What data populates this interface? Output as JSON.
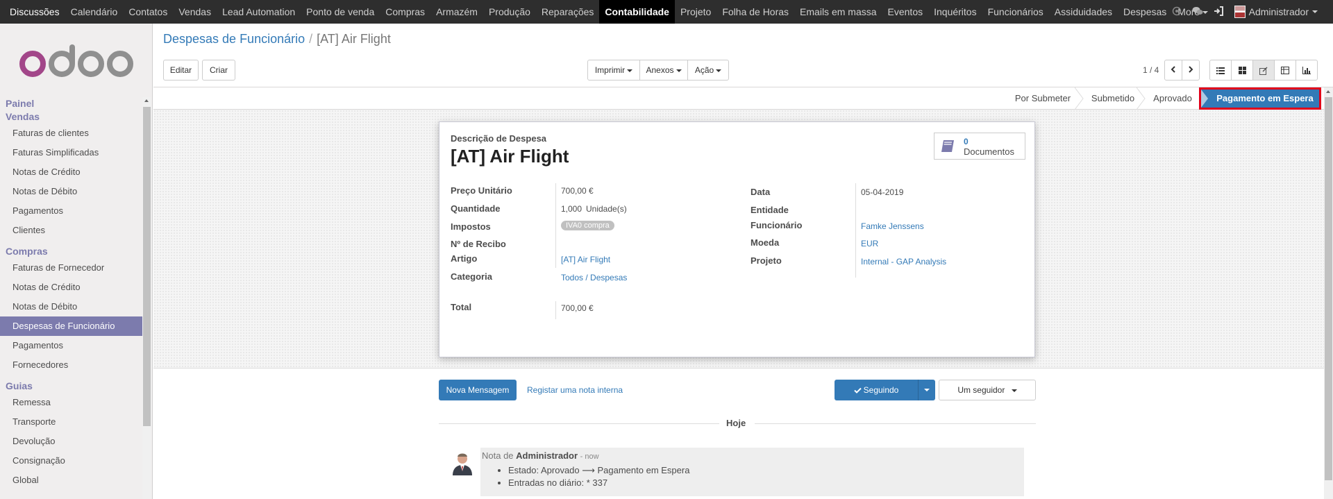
{
  "topbar": {
    "apps": [
      "Discussões",
      "Calendário",
      "Contatos",
      "Vendas",
      "Lead Automation",
      "Ponto de venda",
      "Compras",
      "Armazém",
      "Produção",
      "Reparações",
      "Contabilidade",
      "Projeto",
      "Folha de Horas",
      "Emails em massa",
      "Eventos",
      "Inquéritos",
      "Funcionários",
      "Assiduidades",
      "Despesas"
    ],
    "active_app": "Contabilidade",
    "more_label": "More",
    "user_name": "Administrador"
  },
  "sidebar": {
    "sections": [
      {
        "title": "Painel",
        "items": []
      },
      {
        "title": "Vendas",
        "items": [
          "Faturas de clientes",
          "Faturas Simplificadas",
          "Notas de Crédito",
          "Notas de Débito",
          "Pagamentos",
          "Clientes"
        ]
      },
      {
        "title": "Compras",
        "items": [
          "Faturas de Fornecedor",
          "Notas de Crédito",
          "Notas de Débito",
          "Despesas de Funcionário",
          "Pagamentos",
          "Fornecedores"
        ]
      },
      {
        "title": "Guias",
        "items": [
          "Remessa",
          "Transporte",
          "Devolução",
          "Consignação",
          "Global"
        ]
      }
    ],
    "active_item": "Despesas de Funcionário"
  },
  "breadcrumb": {
    "parent": "Despesas de Funcionário",
    "current": "[AT] Air Flight"
  },
  "toolbar": {
    "edit_label": "Editar",
    "create_label": "Criar",
    "print_label": "Imprimir",
    "attachments_label": "Anexos",
    "action_label": "Ação",
    "pager": "1 / 4"
  },
  "stages": [
    "Por Submeter",
    "Submetido",
    "Aprovado",
    "Pagamento em Espera"
  ],
  "current_stage": "Pagamento em Espera",
  "form": {
    "description_label": "Descrição de Despesa",
    "title": "[AT] Air Flight",
    "documents_count": "0",
    "documents_label": "Documentos",
    "left_fields": {
      "unit_price_label": "Preço Unitário",
      "unit_price": "700,00 €",
      "quantity_label": "Quantidade",
      "quantity": "1,000",
      "uom": "Unidade(s)",
      "taxes_label": "Impostos",
      "tax_badge": "IVA0 compra",
      "receipt_label": "Nº de Recibo",
      "product_label": "Artigo",
      "product": "[AT] Air Flight",
      "category_label": "Categoria",
      "category": "Todos / Despesas",
      "total_label": "Total",
      "total": "700,00 €"
    },
    "right_fields": {
      "date_label": "Data",
      "date": "05-04-2019",
      "entity_label": "Entidade",
      "employee_label": "Funcionário",
      "employee": "Famke Jenssens",
      "currency_label": "Moeda",
      "currency": "EUR",
      "project_label": "Projeto",
      "project": "Internal - GAP Analysis"
    }
  },
  "chatter": {
    "new_message_label": "Nova Mensagem",
    "log_note_label": "Registar uma nota interna",
    "following_label": "Seguindo",
    "followers_label": "Um seguidor",
    "today_label": "Hoje",
    "message": {
      "prefix": "Nota de",
      "author": "Administrador",
      "time": "- now",
      "changes": [
        "Estado: Aprovado ⟶ Pagamento em Espera",
        "Entradas no diário: * 337"
      ]
    }
  },
  "colors": {
    "accent": "#7c7bad",
    "primary": "#337ab7",
    "topbar": "#2e2e2e",
    "highlight_border": "#e2001a"
  }
}
